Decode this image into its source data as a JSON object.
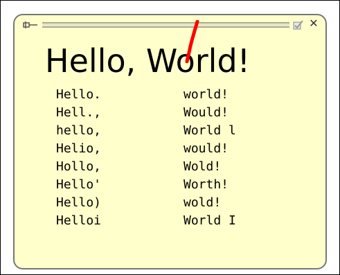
{
  "widget": {
    "recognized_text": "Hello, World!",
    "title_bar": {
      "pin_icon": "pin-icon",
      "check_icon": "checkbox-icon",
      "close_glyph": "✕"
    },
    "candidates": [
      {
        "left": "Hello.",
        "right": "world!"
      },
      {
        "left": "Hell.,",
        "right": "Would!"
      },
      {
        "left": "hello,",
        "right": "World l"
      },
      {
        "left": "Helio,",
        "right": "would!"
      },
      {
        "left": "Hollo,",
        "right": "Wold!"
      },
      {
        "left": "Hello'",
        "right": "Worth!"
      },
      {
        "left": "Hello)",
        "right": "wold!"
      },
      {
        "left": "Helloi",
        "right": "World I"
      }
    ]
  },
  "colors": {
    "widget_background": "#ffffcc",
    "ink_stroke": "#ff0000",
    "border": "#777777"
  }
}
